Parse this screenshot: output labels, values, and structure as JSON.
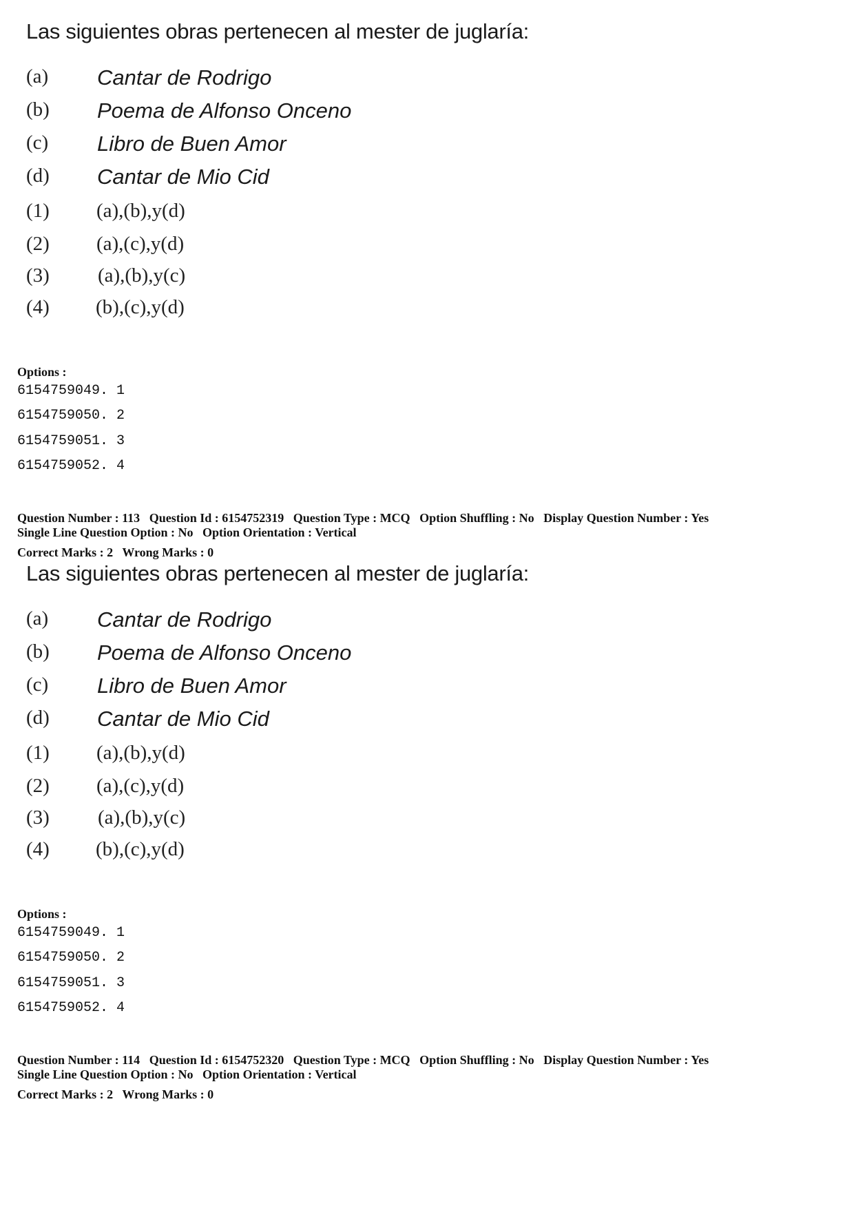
{
  "questions": [
    {
      "stem": "Las siguientes obras pertenecen al mester de juglaría:",
      "items": [
        {
          "label": "(a)",
          "text": "Cantar de Rodrigo"
        },
        {
          "label": "(b)",
          "text": "Poema de Alfonso Onceno"
        },
        {
          "label": "(c)",
          "text": "Libro de Buen Amor"
        },
        {
          "label": "(d)",
          "text": "Cantar de Mio Cid"
        }
      ],
      "choices": [
        {
          "label": "(1)",
          "text": "(a),(b),y(d)"
        },
        {
          "label": "(2)",
          "text": "(a),(c),y(d)"
        },
        {
          "label": "(3)",
          "text": "(a),(b),y(c)"
        },
        {
          "label": "(4)",
          "text": "(b),(c),y(d)"
        }
      ],
      "options_heading": "Options :",
      "options": [
        "6154759049. 1",
        "6154759050. 2",
        "6154759051. 3",
        "6154759052. 4"
      ]
    },
    {
      "meta_line1": [
        "Question Number : 113",
        "Question Id : 6154752319",
        "Question Type : MCQ",
        "Option Shuffling : No",
        "Display Question Number : Yes"
      ],
      "meta_line2": [
        "Single Line Question Option : No",
        "Option Orientation : Vertical"
      ],
      "marks": [
        "Correct Marks : 2",
        "Wrong Marks : 0"
      ],
      "stem": "Las siguientes obras pertenecen al mester de juglaría:",
      "items": [
        {
          "label": "(a)",
          "text": "Cantar de Rodrigo"
        },
        {
          "label": "(b)",
          "text": "Poema de Alfonso Onceno"
        },
        {
          "label": "(c)",
          "text": "Libro de Buen Amor"
        },
        {
          "label": "(d)",
          "text": "Cantar de Mio Cid"
        }
      ],
      "choices": [
        {
          "label": "(1)",
          "text": "(a),(b),y(d)"
        },
        {
          "label": "(2)",
          "text": "(a),(c),y(d)"
        },
        {
          "label": "(3)",
          "text": "(a),(b),y(c)"
        },
        {
          "label": "(4)",
          "text": "(b),(c),y(d)"
        }
      ],
      "options_heading": "Options :",
      "options": [
        "6154759049. 1",
        "6154759050. 2",
        "6154759051. 3",
        "6154759052. 4"
      ]
    },
    {
      "meta_line1": [
        "Question Number : 114",
        "Question Id : 6154752320",
        "Question Type : MCQ",
        "Option Shuffling : No",
        "Display Question Number : Yes"
      ],
      "meta_line2": [
        "Single Line Question Option : No",
        "Option Orientation : Vertical"
      ],
      "marks": [
        "Correct Marks : 2",
        "Wrong Marks : 0"
      ]
    }
  ]
}
